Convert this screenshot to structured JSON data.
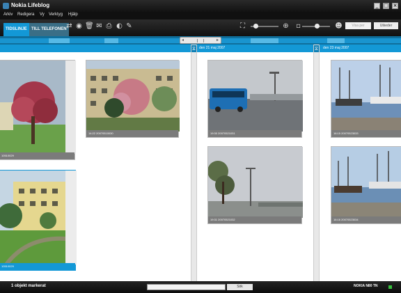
{
  "window": {
    "title": "Nokia Lifeblog"
  },
  "menu": [
    "Arkiv",
    "Redigera",
    "Vy",
    "Verktyg",
    "Hjälp"
  ],
  "tabs": [
    {
      "label": "TIDSLINJE",
      "active": true
    },
    {
      "label": "TILL TELEFONEN",
      "active": false
    }
  ],
  "toolbar": {
    "icons": [
      "sync-icon",
      "refresh-icon",
      "trash-icon",
      "mail-icon",
      "print-icon",
      "web-icon",
      "edit-icon"
    ],
    "search_placeholder": "Visa per",
    "button_label": "Utkeder"
  },
  "timeline": {
    "days": [
      {
        "label": ""
      },
      {
        "label": "den 21 maj 2007"
      },
      {
        "label": "den 23 maj 2007"
      }
    ],
    "photos": [
      {
        "caption": "10510029",
        "scene": "tree",
        "selected": false
      },
      {
        "caption": "14:22 20070510030",
        "scene": "building",
        "selected": false
      },
      {
        "caption": "10510029",
        "scene": "building-green",
        "selected": true
      },
      {
        "caption": "19:30 20070521031",
        "scene": "bus",
        "selected": false
      },
      {
        "caption": "19:31 20070521032",
        "scene": "sky-trees",
        "selected": false
      },
      {
        "caption": "16:15 20070523033",
        "scene": "ship",
        "selected": false
      },
      {
        "caption": "16:16 20070523034",
        "scene": "ship",
        "selected": false
      }
    ]
  },
  "status": {
    "message": "1 objekt markerat",
    "search_button": "Sök",
    "device": "NOKIA N80 TN"
  },
  "colors": {
    "accent": "#1398d6",
    "dark": "#111111",
    "status_led": "#37c13d"
  }
}
